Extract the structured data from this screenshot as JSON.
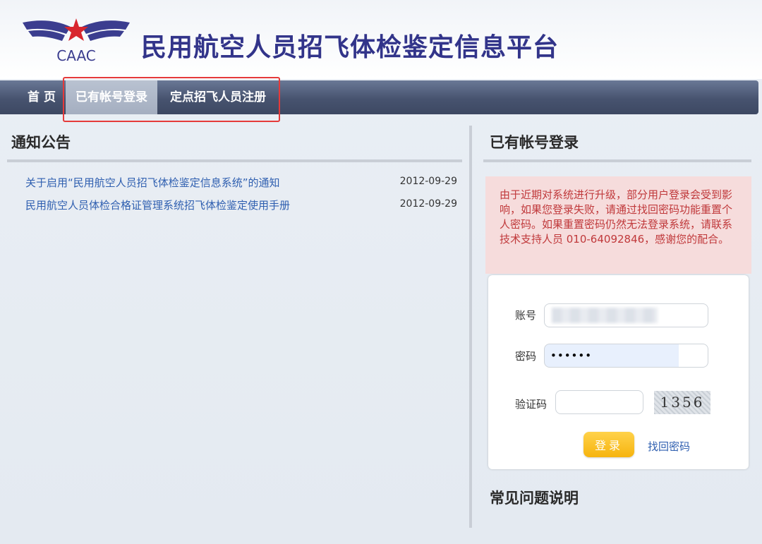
{
  "header": {
    "logo_text": "CAAC",
    "site_title": "民用航空人员招飞体检鉴定信息平台"
  },
  "nav": {
    "items": [
      {
        "label": "首 页"
      },
      {
        "label": "已有帐号登录"
      },
      {
        "label": "定点招飞人员注册"
      }
    ]
  },
  "notice": {
    "title": "通知公告",
    "items": [
      {
        "title": "关于启用“民用航空人员招飞体检鉴定信息系统”的通知",
        "date": "2012-09-29"
      },
      {
        "title": "民用航空人员体检合格证管理系统招飞体检鉴定使用手册",
        "date": "2012-09-29"
      }
    ]
  },
  "login": {
    "title": "已有帐号登录",
    "alert": "由于近期对系统进行升级，部分用户登录会受到影响，如果您登录失败，请通过找回密码功能重置个人密码。如果重置密码仍然无法登录系统，请联系技术支持人员 010-64092846，感谢您的配合。",
    "account_label": "账号",
    "password_label": "密码",
    "password_value": "••••••",
    "captcha_label": "验证码",
    "captcha_value": "",
    "captcha_image_text": "1356",
    "submit_label": "登录",
    "forgot_label": "找回密码"
  },
  "faq": {
    "title": "常见问题说明"
  },
  "colors": {
    "title": "#32348a",
    "nav": "#47536f",
    "link": "#2f5fb0",
    "alert_text": "#c0393b",
    "alert_bg": "#f6dcdc",
    "button": "#f6b40f",
    "highlight": "#e53a3a"
  }
}
